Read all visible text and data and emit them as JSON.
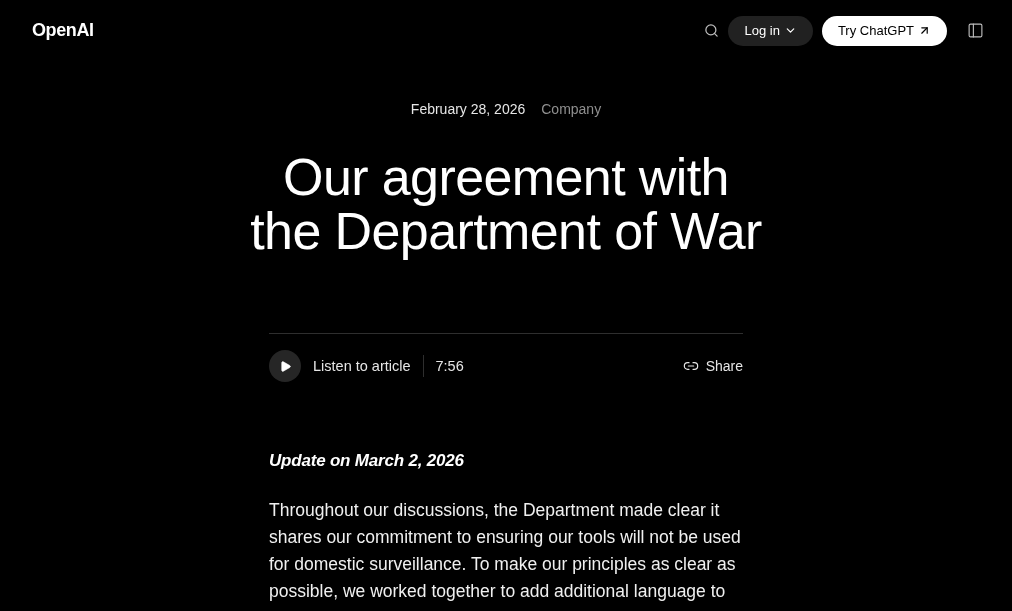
{
  "header": {
    "logo": "OpenAI",
    "login_button": "Log in",
    "try_button": "Try ChatGPT"
  },
  "article": {
    "date": "February 28, 2026",
    "category": "Company",
    "title": "Our agreement with the Department of War",
    "audio": {
      "label": "Listen to article",
      "duration": "7:56"
    },
    "share": "Share",
    "update_note": "Update on March 2, 2026",
    "paragraphs": [
      "Throughout our discussions, the Department made clear it shares our commitment to ensuring our tools will not be used for domestic surveillance. To make our principles as clear as possible, we worked together to add additional language to"
    ]
  }
}
